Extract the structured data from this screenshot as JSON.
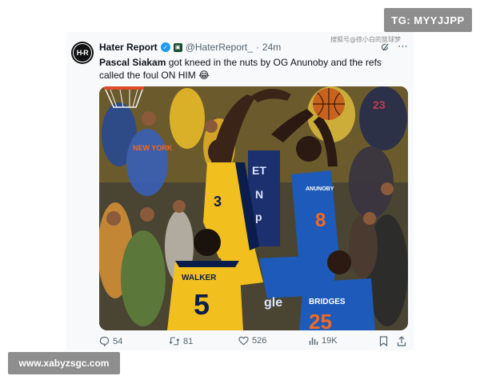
{
  "watermarks": {
    "top_right": "TG: MYYJJPP",
    "bottom_left": "www.xabyzsgc.com",
    "media_overlay_cn": "搜狐号@徐小白的篮球梦"
  },
  "tweet": {
    "avatar_text": "H-R",
    "display_name": "Hater Report",
    "handle": "@HaterReport_",
    "separator": "·",
    "time": "24m",
    "text_bold": "Pascal Siakam",
    "text_rest": " got kneed in the nuts by OG Anunoby and the refs called the foul ON HIM 😂",
    "icons": [
      "verified-icon",
      "affiliate-icon",
      "grok-icon",
      "more-icon"
    ],
    "media_alt_jerseys": {
      "pacers_player_name": "WALKER",
      "pacers_player_number": "5",
      "pacers_player_number_2": "3",
      "knicks_player_name": "ANUNOBY",
      "knicks_player_number": "8",
      "knicks_player_name_2": "BRIDGES",
      "knicks_player_number_2": "25",
      "fan_shirt_text": "NEW YORK",
      "background_number": "23"
    },
    "actions": {
      "replies": "54",
      "reposts": "81",
      "likes": "526",
      "views": "19K"
    },
    "colors": {
      "accent_blue": "#1d9bf0",
      "knicks_blue": "#1d5ab9",
      "knicks_orange": "#f26a21",
      "pacers_gold": "#f2c01e",
      "pacers_navy": "#0b1d4a"
    }
  }
}
